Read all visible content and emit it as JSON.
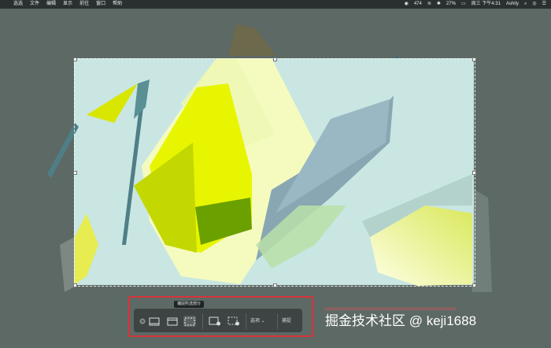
{
  "menubar": {
    "items": [
      "选选",
      "文件",
      "编辑",
      "显示",
      "前往",
      "窗口",
      "帮助"
    ],
    "status": {
      "app_badge": "474",
      "battery": "27%",
      "clock": "周三 下午4:31",
      "user": "Ashily"
    }
  },
  "toolbar": {
    "tooltip": "捕捉所选部分",
    "options_label": "选项",
    "capture_label": "捕捉"
  },
  "watermark": {
    "text": "掘金技术社区 @ keji1688"
  },
  "colors": {
    "background": "#5d6965",
    "selection_fill": "#c9e6e2",
    "accent_yellow": "#e8f500",
    "highlight_red": "#d8333a"
  }
}
